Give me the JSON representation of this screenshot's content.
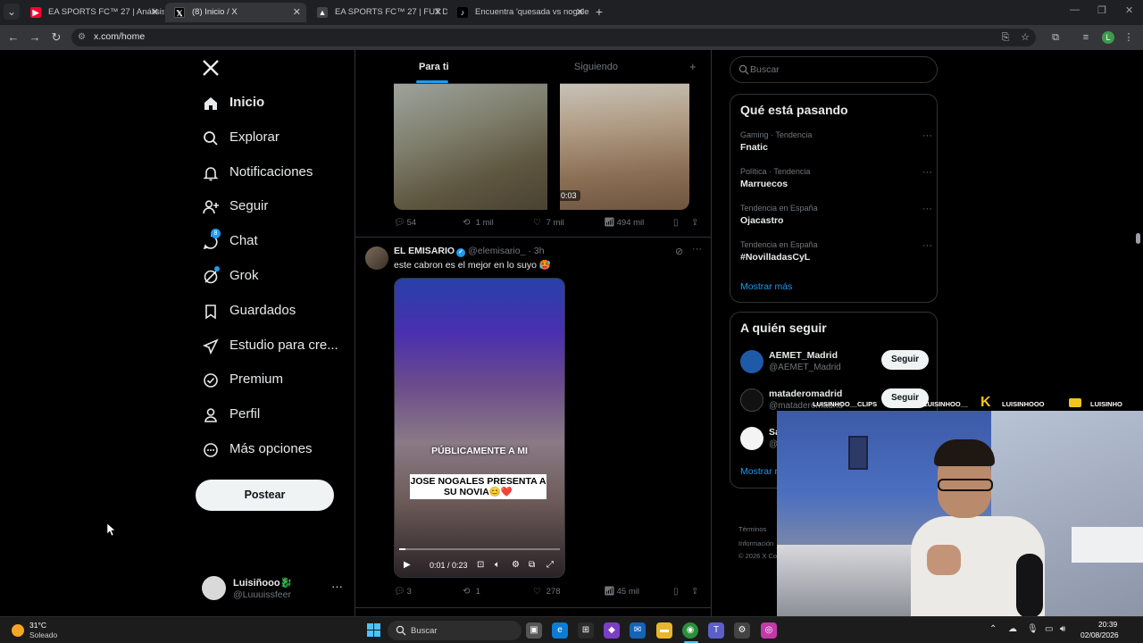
{
  "browser": {
    "tabs": [
      {
        "title": "EA SPORTS FC™ 27 | Análisis de",
        "icon": "youtube-icon",
        "color": "#ff0033"
      },
      {
        "title": "(8) Inicio / X",
        "icon": "x-logo-icon",
        "color": "#000000"
      },
      {
        "title": "EA SPORTS FC™ 27 | FUT Deep",
        "icon": "ea-icon",
        "color": "#444444"
      },
      {
        "title": "Encuentra 'quesada vs nogales'",
        "icon": "tiktok-icon",
        "color": "#000000"
      }
    ],
    "url": "x.com/home",
    "profile_initial": "L"
  },
  "nav": {
    "items": [
      {
        "label": "Inicio",
        "icon": "home-icon"
      },
      {
        "label": "Explorar",
        "icon": "search-icon"
      },
      {
        "label": "Notificaciones",
        "icon": "bell-icon"
      },
      {
        "label": "Seguir",
        "icon": "follow-icon"
      },
      {
        "label": "Chat",
        "icon": "chat-icon",
        "badge": "8"
      },
      {
        "label": "Grok",
        "icon": "grok-icon"
      },
      {
        "label": "Guardados",
        "icon": "bookmark-icon"
      },
      {
        "label": "Estudio para cre...",
        "icon": "rocket-icon"
      },
      {
        "label": "Premium",
        "icon": "premium-icon"
      },
      {
        "label": "Perfil",
        "icon": "person-icon"
      },
      {
        "label": "Más opciones",
        "icon": "more-circle-icon"
      }
    ],
    "post_label": "Postear",
    "account": {
      "name": "Luisiñooo🐉",
      "handle": "@Luuuissfeer"
    }
  },
  "timeline": {
    "tabs": [
      "Para ti",
      "Siguiendo"
    ],
    "tweet1": {
      "video_time": "0:03",
      "replies": "54",
      "reposts": "1 mil",
      "likes": "7 mil",
      "views": "494 mil"
    },
    "tweet2": {
      "name": "EL EMISARIO",
      "handle": "@elemisario_",
      "time": "· 3h",
      "text": "este cabron es el mejor en lo suyo 🥵",
      "caption1": "PÚBLICAMENTE A MI",
      "caption2": "JOSE NOGALES PRESENTA A SU NOVIA😊❤️",
      "video_time": "0:01 / 0:23",
      "progress": 0.04,
      "replies": "3",
      "reposts": "1",
      "likes": "278",
      "views": "45 mil"
    }
  },
  "right": {
    "search_placeholder": "Buscar",
    "trends_title": "Qué está pasando",
    "trends": [
      {
        "meta": "Gaming · Tendencia",
        "topic": "Fnatic"
      },
      {
        "meta": "Política · Tendencia",
        "topic": "Marruecos"
      },
      {
        "meta": "Tendencia en España",
        "topic": "Ojacastro"
      },
      {
        "meta": "Tendencia en España",
        "topic": "#NovilladasCyL"
      }
    ],
    "show_more": "Mostrar más",
    "who_title": "A quién seguir",
    "who": [
      {
        "name": "AEMET_Madrid",
        "handle": "@AEMET_Madrid",
        "button": "Seguir"
      },
      {
        "name": "mataderomadrid",
        "handle": "@mataderomadrid",
        "button": "Seguir"
      },
      {
        "name": "Sa",
        "handle": "@",
        "button": ""
      }
    ],
    "who_more": "Mostrar m",
    "footer1": "Términos",
    "footer2": "Información",
    "footer3": "© 2026 X Co"
  },
  "overlay": {
    "labels": [
      "LUISINHOO__CLIPS",
      "LUISINHOO__",
      "LUISINHOOO",
      "LUISINHO"
    ]
  },
  "taskbar": {
    "temp": "31°C",
    "weather": "Soleado",
    "search": "Buscar",
    "time": "20:39",
    "date": "02/08/2026"
  }
}
